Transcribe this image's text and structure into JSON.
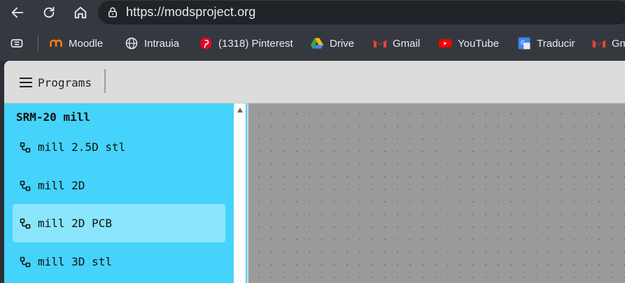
{
  "browser": {
    "url": "https://modsproject.org",
    "bookmarks": [
      {
        "label": "Moodle",
        "icon": "moodle-icon"
      },
      {
        "label": "Intrauia",
        "icon": "globe-icon"
      },
      {
        "label": "(1318) Pinterest",
        "icon": "pinterest-icon"
      },
      {
        "label": "Drive",
        "icon": "drive-icon"
      },
      {
        "label": "Gmail",
        "icon": "gmail-icon"
      },
      {
        "label": "YouTube",
        "icon": "youtube-icon"
      },
      {
        "label": "Traducir",
        "icon": "translate-icon"
      },
      {
        "label": "Gm",
        "icon": "gmail-icon"
      }
    ]
  },
  "app": {
    "programs_label": "Programs",
    "sidebar": {
      "heading": "SRM-20 mill",
      "items": [
        {
          "label": "mill 2.5D stl"
        },
        {
          "label": "mill 2D"
        },
        {
          "label": "mill 2D PCB"
        },
        {
          "label": "mill 3D stl"
        }
      ]
    }
  },
  "colors": {
    "sidebar_bg": "#45d3fb",
    "selected_bg": "#8ae5fd",
    "canvas_bg": "#9a9a9a",
    "chrome_bg": "#35393f"
  }
}
